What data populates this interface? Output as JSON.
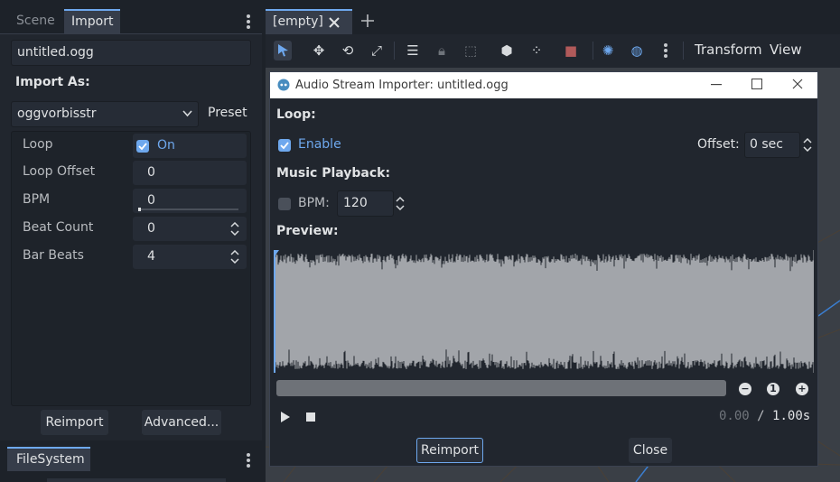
{
  "left_dock": {
    "tabs": [
      {
        "label": "Scene",
        "active": false
      },
      {
        "label": "Import",
        "active": true
      }
    ],
    "file_name": "untitled.ogg",
    "import_as_label": "Import As:",
    "import_as_value": "oggvorbisstr",
    "preset_label": "Preset",
    "properties": [
      {
        "label": "Loop",
        "value": "On",
        "kind": "checkbox"
      },
      {
        "label": "Loop Offset",
        "value": "0",
        "kind": "number"
      },
      {
        "label": "BPM",
        "value": "0",
        "kind": "slider"
      },
      {
        "label": "Beat Count",
        "value": "0",
        "kind": "spin"
      },
      {
        "label": "Bar Beats",
        "value": "4",
        "kind": "spin"
      }
    ],
    "reimport_label": "Reimport",
    "advanced_label": "Advanced...",
    "filesystem_tab": "FileSystem"
  },
  "editor": {
    "scene_tab": "[empty]",
    "transform_menu": "Transform",
    "view_menu": "View"
  },
  "dialog": {
    "title": "Audio Stream Importer: untitled.ogg",
    "loop_section": "Loop:",
    "enable_label": "Enable",
    "offset_label": "Offset:",
    "offset_value": "0 sec",
    "music_section": "Music Playback:",
    "bpm_label": "BPM:",
    "bpm_value": "120",
    "preview_section": "Preview:",
    "time_current": "0.00",
    "time_separator": "/",
    "time_total": "1.00s",
    "zoom_reset_label": "1",
    "reimport_label": "Reimport",
    "close_label": "Close"
  },
  "colors": {
    "accent": "#6ea8ee",
    "panel": "#21262e",
    "waveform_bg": "#a2a5aa",
    "waveform_fg": "#21262e"
  }
}
